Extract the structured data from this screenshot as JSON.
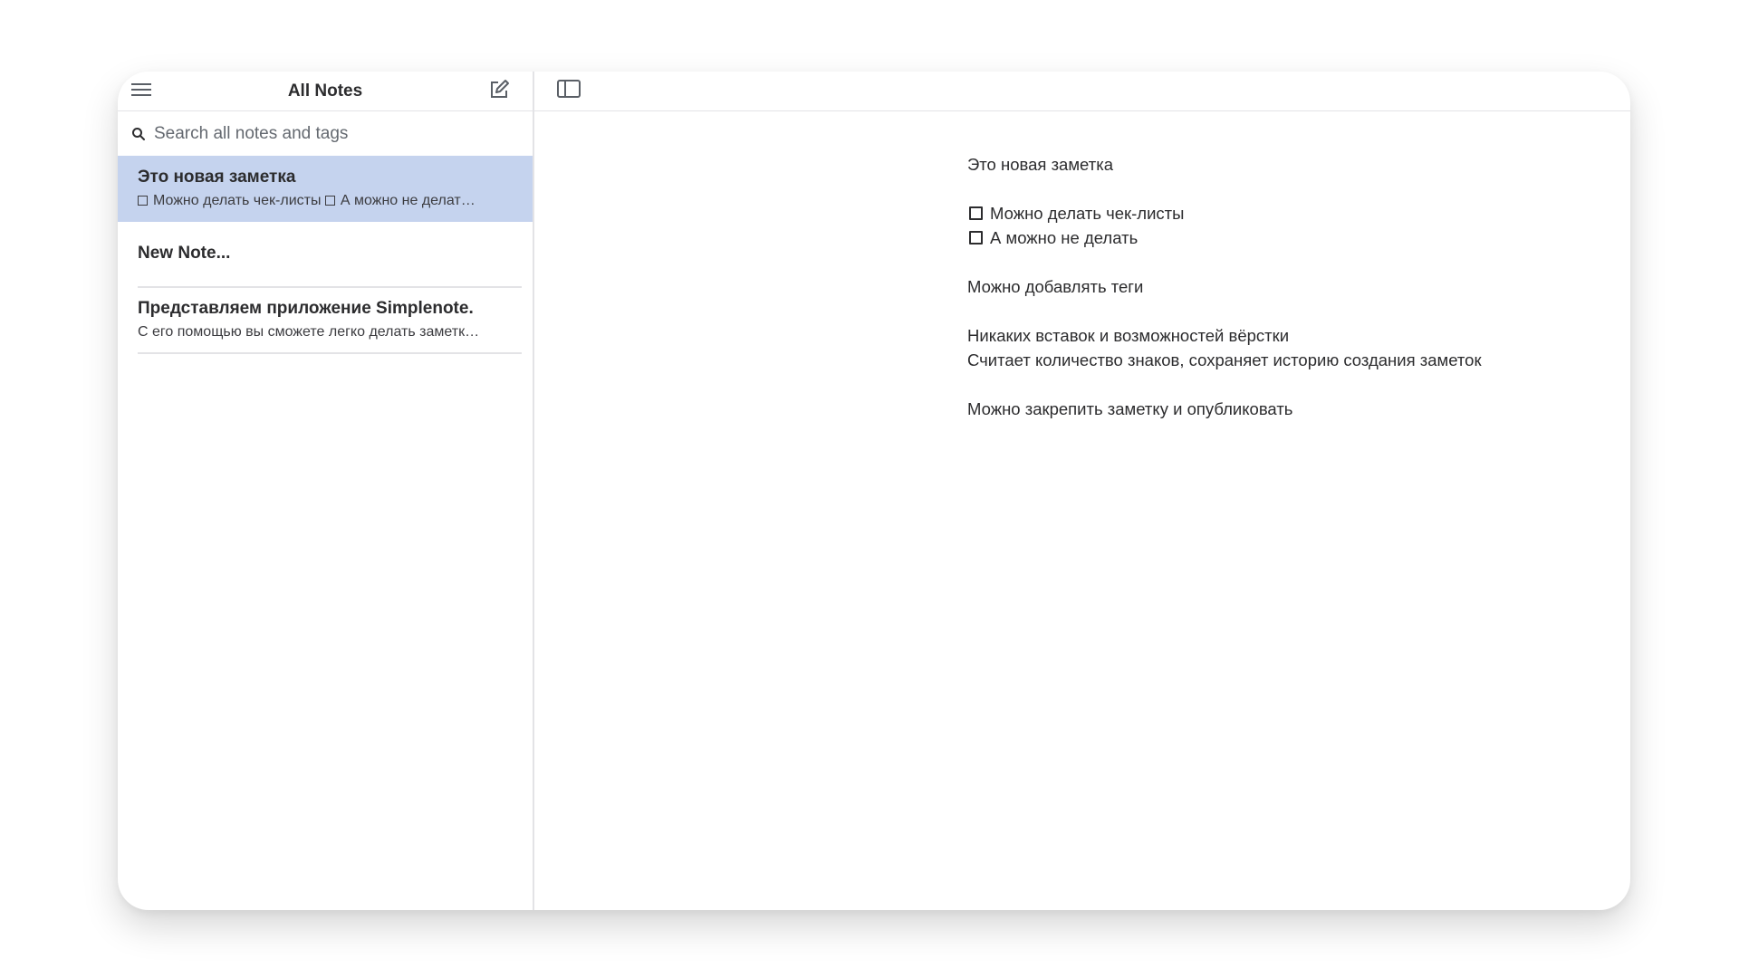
{
  "colors": {
    "selected_row_bg": "#c5d3ee",
    "text": "#2c2c2e",
    "divider": "#e3e3e6",
    "icon": "#5a5f66"
  },
  "sidebar": {
    "menu_icon": "hamburger-menu-icon",
    "title": "All Notes",
    "new_note_icon": "compose-icon",
    "search": {
      "icon": "search-icon",
      "placeholder": "Search all notes and tags",
      "value": ""
    },
    "notes": [
      {
        "title": "Это новая заметка",
        "preview_parts": [
          "Можно делать чек-листы",
          "А можно не делат…"
        ],
        "selected": true
      },
      {
        "title": "New Note...",
        "preview": "",
        "selected": false
      },
      {
        "title": "Представляем приложение Simplenote.",
        "preview": "С его помощью вы сможете легко делать заметк…",
        "selected": false
      }
    ]
  },
  "editor": {
    "toolbar": {
      "sidebar_toggle_icon": "sidebar-toggle-icon"
    },
    "content": {
      "title_line": "Это новая заметка",
      "checklist": [
        {
          "text": "Можно делать чек-листы",
          "checked": false
        },
        {
          "text": "А можно не делать",
          "checked": false
        }
      ],
      "line_tags": "Можно добавлять теги",
      "line_no_layout": "Никаких вставок и возможностей вёрстки",
      "line_counts": "Считает количество знаков, сохраняет историю создания заметок",
      "line_pin": "Можно закрепить заметку и опубликовать"
    }
  }
}
